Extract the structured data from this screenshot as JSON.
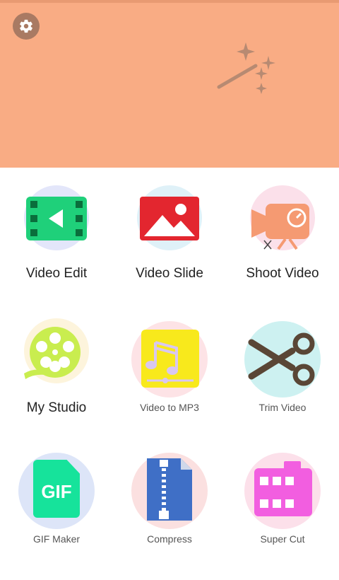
{
  "banner": {
    "settings_icon": "gear-icon",
    "decor_icon": "magic-wand-icon",
    "bg_color": "#f9ac84"
  },
  "tools": [
    {
      "label": "Video Edit",
      "icon": "video-edit-icon"
    },
    {
      "label": "Video Slide",
      "icon": "image-slide-icon"
    },
    {
      "label": "Shoot Video",
      "icon": "camera-icon"
    },
    {
      "label": "My Studio",
      "icon": "film-reel-icon"
    },
    {
      "label": "Video to MP3",
      "icon": "music-note-icon"
    },
    {
      "label": "Trim Video",
      "icon": "scissors-icon"
    },
    {
      "label": "GIF Maker",
      "icon": "gif-icon"
    },
    {
      "label": "Compress",
      "icon": "zip-file-icon"
    },
    {
      "label": "Super Cut",
      "icon": "super-cut-icon"
    }
  ],
  "gif_text": "GIF"
}
